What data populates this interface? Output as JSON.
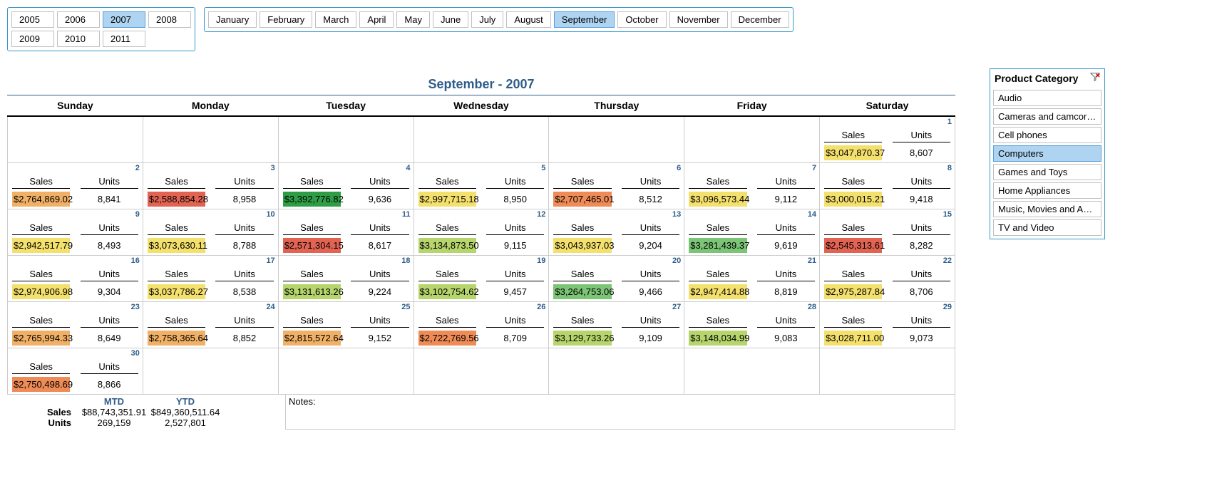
{
  "years": [
    {
      "label": "2005",
      "selected": false
    },
    {
      "label": "2006",
      "selected": false
    },
    {
      "label": "2007",
      "selected": true
    },
    {
      "label": "2008",
      "selected": false
    },
    {
      "label": "2009",
      "selected": false
    },
    {
      "label": "2010",
      "selected": false
    },
    {
      "label": "2011",
      "selected": false
    }
  ],
  "months": [
    {
      "label": "January",
      "selected": false
    },
    {
      "label": "February",
      "selected": false
    },
    {
      "label": "March",
      "selected": false
    },
    {
      "label": "April",
      "selected": false
    },
    {
      "label": "May",
      "selected": false
    },
    {
      "label": "June",
      "selected": false
    },
    {
      "label": "July",
      "selected": false
    },
    {
      "label": "August",
      "selected": false
    },
    {
      "label": "September",
      "selected": true
    },
    {
      "label": "October",
      "selected": false
    },
    {
      "label": "November",
      "selected": false
    },
    {
      "label": "December",
      "selected": false
    }
  ],
  "title": "September - 2007",
  "weekdays": [
    "Sunday",
    "Monday",
    "Tuesday",
    "Wednesday",
    "Thursday",
    "Friday",
    "Saturday"
  ],
  "labels": {
    "sales": "Sales",
    "units": "Units",
    "notes": "Notes:",
    "mtd": "MTD",
    "ytd": "YTD"
  },
  "days": {
    "1": {
      "sales": "$3,047,870.37",
      "units": "8,607",
      "color": "shade-yellow"
    },
    "2": {
      "sales": "$2,764,869.02",
      "units": "8,841",
      "color": "shade-orange"
    },
    "3": {
      "sales": "$2,588,854.28",
      "units": "8,958",
      "color": "shade-red"
    },
    "4": {
      "sales": "$3,392,776.82",
      "units": "9,636",
      "color": "shade-green1"
    },
    "5": {
      "sales": "$2,997,715.18",
      "units": "8,950",
      "color": "shade-yellow"
    },
    "6": {
      "sales": "$2,707,465.01",
      "units": "8,512",
      "color": "shade-orange2"
    },
    "7": {
      "sales": "$3,096,573.44",
      "units": "9,112",
      "color": "shade-yellow"
    },
    "8": {
      "sales": "$3,000,015.21",
      "units": "9,418",
      "color": "shade-yellow"
    },
    "9": {
      "sales": "$2,942,517.79",
      "units": "8,493",
      "color": "shade-yellow"
    },
    "10": {
      "sales": "$3,073,630.11",
      "units": "8,788",
      "color": "shade-yellow"
    },
    "11": {
      "sales": "$2,571,304.15",
      "units": "8,617",
      "color": "shade-red"
    },
    "12": {
      "sales": "$3,134,873.50",
      "units": "9,115",
      "color": "shade-lime"
    },
    "13": {
      "sales": "$3,043,937.03",
      "units": "9,204",
      "color": "shade-yellow"
    },
    "14": {
      "sales": "$3,281,439.37",
      "units": "9,619",
      "color": "shade-green2"
    },
    "15": {
      "sales": "$2,545,313.61",
      "units": "8,282",
      "color": "shade-red"
    },
    "16": {
      "sales": "$2,974,906.98",
      "units": "9,304",
      "color": "shade-yellow"
    },
    "17": {
      "sales": "$3,037,786.27",
      "units": "8,538",
      "color": "shade-yellow"
    },
    "18": {
      "sales": "$3,131,613.26",
      "units": "9,224",
      "color": "shade-lime"
    },
    "19": {
      "sales": "$3,102,754.62",
      "units": "9,457",
      "color": "shade-lime"
    },
    "20": {
      "sales": "$3,264,753.06",
      "units": "9,466",
      "color": "shade-green2"
    },
    "21": {
      "sales": "$2,947,414.88",
      "units": "8,819",
      "color": "shade-yellow"
    },
    "22": {
      "sales": "$2,975,287.84",
      "units": "8,706",
      "color": "shade-yellow"
    },
    "23": {
      "sales": "$2,765,994.33",
      "units": "8,649",
      "color": "shade-orange"
    },
    "24": {
      "sales": "$2,758,365.64",
      "units": "8,852",
      "color": "shade-orange"
    },
    "25": {
      "sales": "$2,815,572.64",
      "units": "9,152",
      "color": "shade-orange"
    },
    "26": {
      "sales": "$2,722,769.56",
      "units": "8,709",
      "color": "shade-orange2"
    },
    "27": {
      "sales": "$3,129,733.26",
      "units": "9,109",
      "color": "shade-lime"
    },
    "28": {
      "sales": "$3,148,034.99",
      "units": "9,083",
      "color": "shade-lime"
    },
    "29": {
      "sales": "$3,028,711.00",
      "units": "9,073",
      "color": "shade-yellow"
    },
    "30": {
      "sales": "$2,750,498.69",
      "units": "8,866",
      "color": "shade-orange2"
    }
  },
  "grid": [
    [
      null,
      null,
      null,
      null,
      null,
      null,
      "1"
    ],
    [
      "2",
      "3",
      "4",
      "5",
      "6",
      "7",
      "8"
    ],
    [
      "9",
      "10",
      "11",
      "12",
      "13",
      "14",
      "15"
    ],
    [
      "16",
      "17",
      "18",
      "19",
      "20",
      "21",
      "22"
    ],
    [
      "23",
      "24",
      "25",
      "26",
      "27",
      "28",
      "29"
    ],
    [
      "30",
      null,
      null,
      null,
      null,
      null,
      null
    ]
  ],
  "summary": {
    "mtd_sales": "$88,743,351.91",
    "ytd_sales": "$849,360,511.64",
    "mtd_units": "269,159",
    "ytd_units": "2,527,801"
  },
  "category_header": "Product Category",
  "categories": [
    {
      "label": "Audio",
      "selected": false
    },
    {
      "label": "Cameras and camcorders",
      "selected": false
    },
    {
      "label": "Cell phones",
      "selected": false
    },
    {
      "label": "Computers",
      "selected": true
    },
    {
      "label": "Games and Toys",
      "selected": false
    },
    {
      "label": "Home Appliances",
      "selected": false
    },
    {
      "label": "Music, Movies and Aud...",
      "selected": false
    },
    {
      "label": "TV and Video",
      "selected": false
    }
  ]
}
